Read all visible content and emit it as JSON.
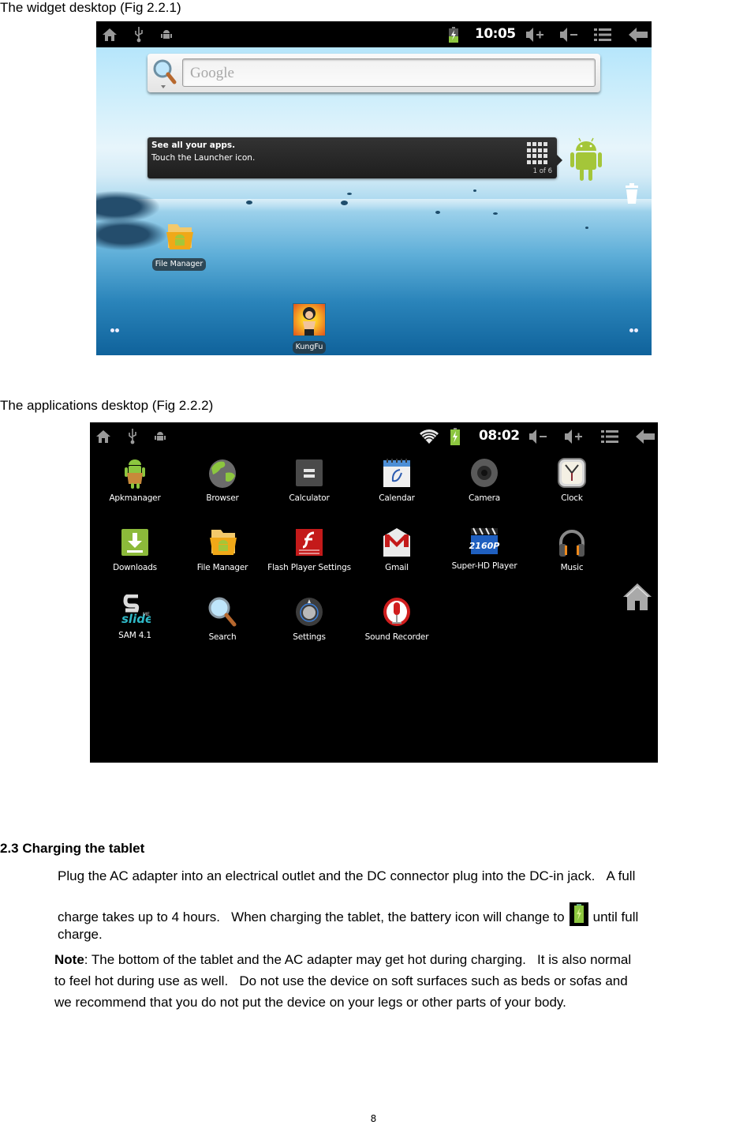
{
  "captions": {
    "fig1": "The widget desktop (Fig 2.2.1)",
    "fig2": "The applications desktop (Fig 2.2.2)"
  },
  "fig1": {
    "statusbar": {
      "left_icons": [
        "home-icon",
        "usb-icon",
        "android-debug-icon"
      ],
      "right_icons": [
        "battery-charging-icon",
        "volume-up-icon",
        "volume-down-icon",
        "menu-icon",
        "back-icon"
      ],
      "time": "10:05"
    },
    "search_widget": {
      "placeholder": "Google",
      "icon": "search-icon"
    },
    "tooltip": {
      "title": "See all your apps.",
      "body": "Touch the Launcher icon.",
      "page": "1 of 6",
      "icon": "launcher-grid-icon"
    },
    "shortcuts": [
      {
        "label": "File Manager",
        "icon": "file-manager-icon"
      },
      {
        "label": "KungFu",
        "icon": "kungfu-game-icon"
      }
    ],
    "launcher_icon": "android-launcher-icon",
    "trash_icon": "trash-icon"
  },
  "fig2": {
    "statusbar": {
      "left_icons": [
        "home-icon",
        "usb-icon",
        "android-debug-icon"
      ],
      "right_icons": [
        "wifi-icon",
        "battery-charging-icon",
        "volume-down-icon",
        "volume-up-icon",
        "menu-icon",
        "back-icon"
      ],
      "time": "08:02"
    },
    "apps": [
      {
        "label": "Apkmanager",
        "icon": "apkmanager-icon"
      },
      {
        "label": "Browser",
        "icon": "browser-icon"
      },
      {
        "label": "Calculator",
        "icon": "calculator-icon"
      },
      {
        "label": "Calendar",
        "icon": "calendar-icon"
      },
      {
        "label": "Camera",
        "icon": "camera-icon"
      },
      {
        "label": "Clock",
        "icon": "clock-icon"
      },
      {
        "label": "Downloads",
        "icon": "downloads-icon"
      },
      {
        "label": "File Manager",
        "icon": "file-manager-icon"
      },
      {
        "label": "Flash Player Settings",
        "icon": "flash-icon"
      },
      {
        "label": "Gmail",
        "icon": "gmail-icon"
      },
      {
        "label": "Super-HD Player",
        "icon": "video-player-icon"
      },
      {
        "label": "Music",
        "icon": "headphones-icon"
      },
      {
        "label": "SAM 4.1",
        "icon": "slideme-icon"
      },
      {
        "label": "Search",
        "icon": "search-icon"
      },
      {
        "label": "Settings",
        "icon": "settings-icon"
      },
      {
        "label": "Sound Recorder",
        "icon": "microphone-icon"
      }
    ],
    "home_button_icon": "home-icon"
  },
  "section": {
    "heading": "2.3 Charging the tablet",
    "para_line1": "Plug the AC adapter into an electrical outlet and the DC connector plug into the DC-in jack.   A full",
    "para_line2_a": "charge takes up to 4 hours.   When charging the tablet, the battery icon will change to",
    "para_line2_b": "until full",
    "para_line3": "charge.",
    "note_label": "Note",
    "note_line1": ": The bottom of the tablet and the AC adapter may get hot during charging.   It is also normal",
    "note_line2": "to feel hot during use as well.   Do not use the device on soft surfaces such as beds or sofas and",
    "note_line3": "we recommend that you do not put the device on your legs or other parts of your body."
  },
  "page_number": "8",
  "colors": {
    "android_green": "#a4c639",
    "battery_green": "#8cc63f",
    "statusbar_bg": "#000000"
  }
}
